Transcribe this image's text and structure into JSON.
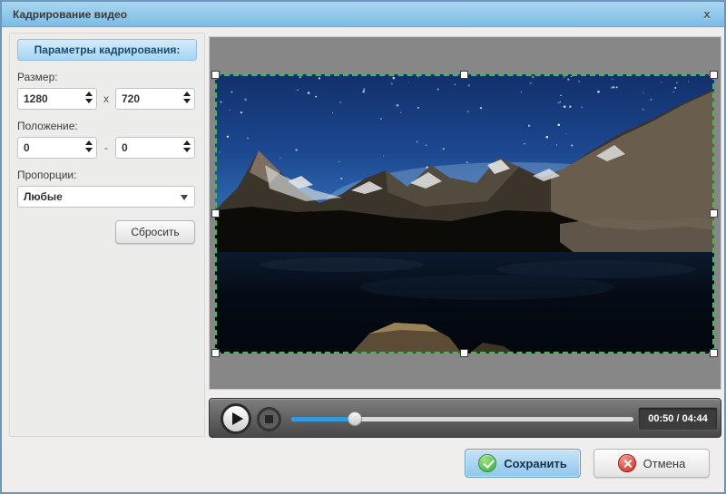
{
  "window": {
    "title": "Кадрирование видео",
    "close_label": "x"
  },
  "sidebar": {
    "header": "Параметры кадрирования:",
    "size": {
      "label": "Размер:",
      "width": "1280",
      "separator": "x",
      "height": "720"
    },
    "position": {
      "label": "Положение:",
      "x": "0",
      "separator": "-",
      "y": "0"
    },
    "proportions": {
      "label": "Пропорции:",
      "value": "Любые"
    },
    "reset_label": "Сбросить"
  },
  "player": {
    "time": "00:50 / 04:44",
    "progress_percent": 18.5,
    "progress_style": "width:70px"
  },
  "actions": {
    "save_label": "Сохранить",
    "cancel_label": "Отмена"
  },
  "colors": {
    "titlebar_blue": "#7cbce5",
    "panel_header_blue": "#a7d5f2",
    "crop_green": "#35c24a",
    "progress_blue": "#3399dd",
    "save_green": "#35ad3c",
    "cancel_red": "#ce2a21"
  }
}
